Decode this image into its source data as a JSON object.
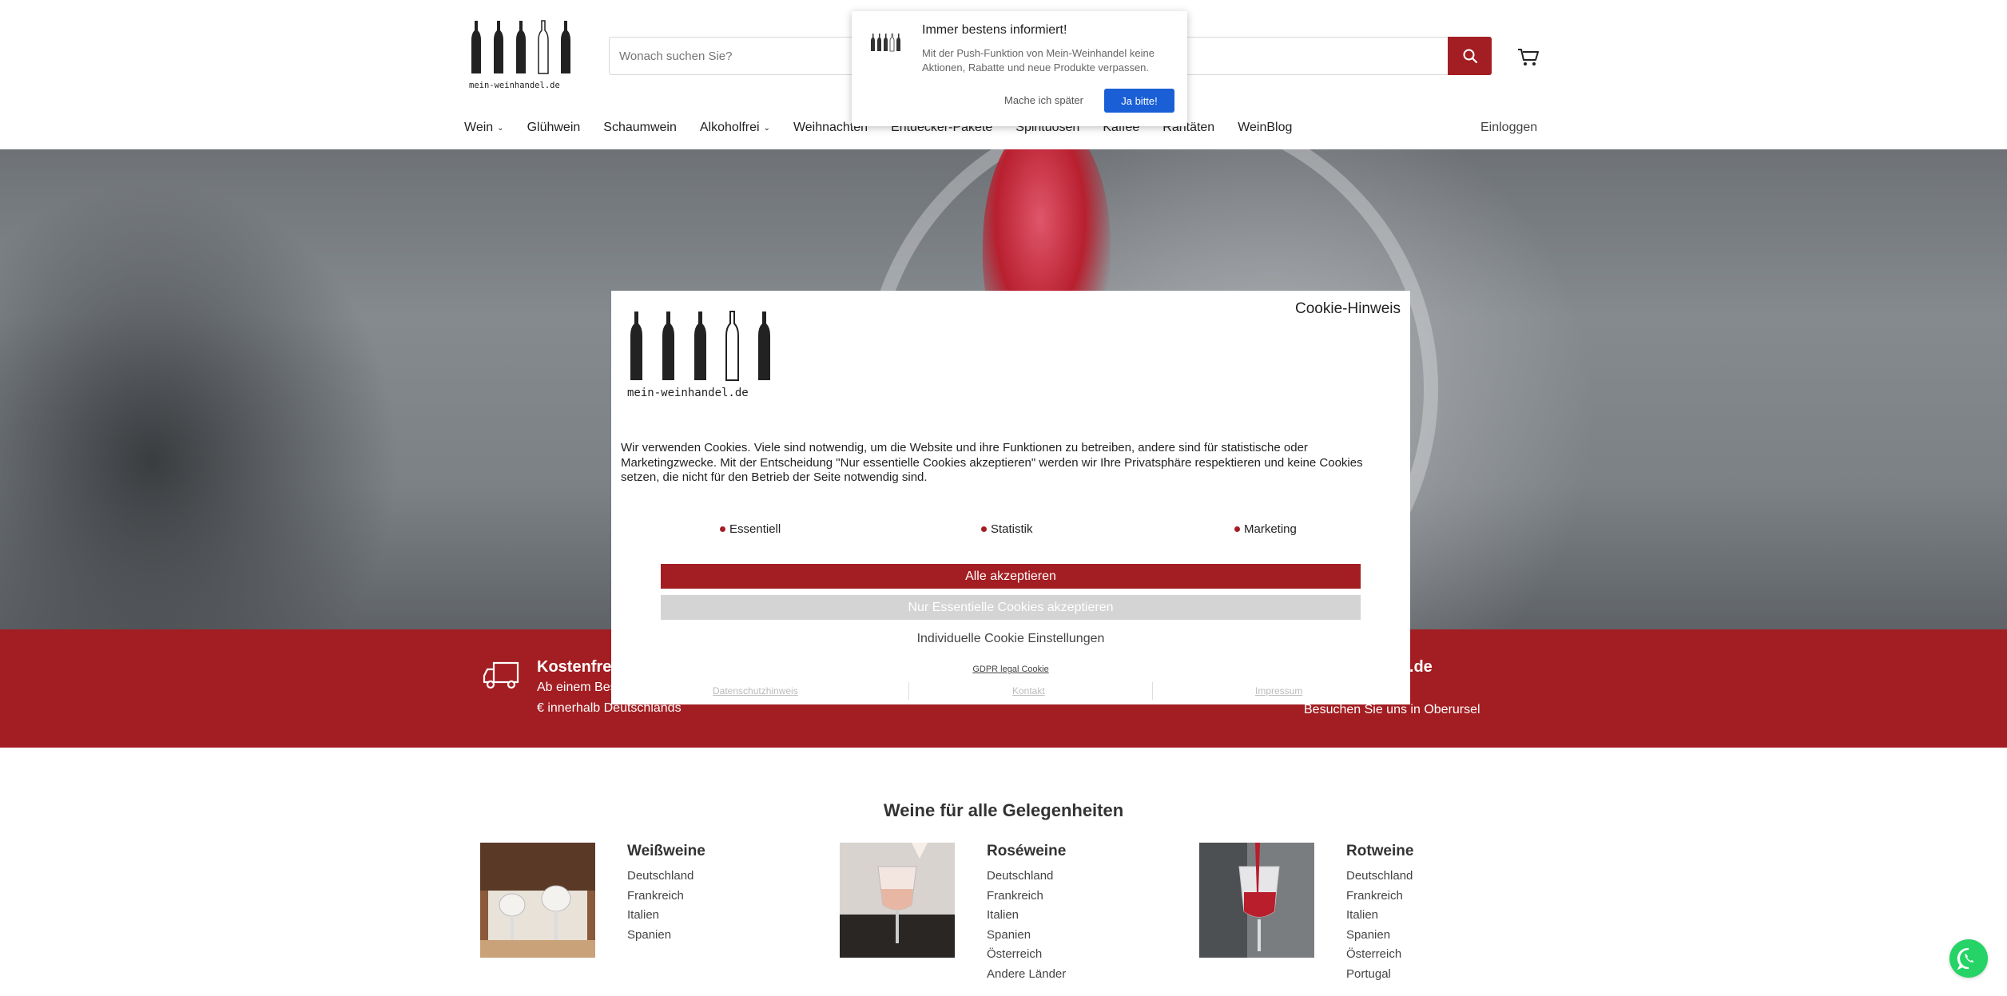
{
  "header": {
    "logo_text": "mein-weinhandel.de",
    "search_placeholder": "Wonach suchen Sie?",
    "login_label": "Einloggen"
  },
  "nav": {
    "items": [
      {
        "label": "Wein",
        "has_dropdown": true
      },
      {
        "label": "Glühwein",
        "has_dropdown": false
      },
      {
        "label": "Schaumwein",
        "has_dropdown": false
      },
      {
        "label": "Alkoholfrei",
        "has_dropdown": true
      },
      {
        "label": "Weihnachten",
        "has_dropdown": false
      },
      {
        "label": "Entdecker-Pakete",
        "has_dropdown": false
      },
      {
        "label": "Spirituosen",
        "has_dropdown": false
      },
      {
        "label": "Kaffee",
        "has_dropdown": false
      },
      {
        "label": "Raritäten",
        "has_dropdown": false
      },
      {
        "label": "WeinBlog",
        "has_dropdown": false
      }
    ]
  },
  "push_popup": {
    "title": "Immer bestens informiert!",
    "text": "Mit der Push-Funktion von Mein-Weinhandel keine Aktionen, Rabatte und neue Produkte verpassen.",
    "later_label": "Mache ich später",
    "accept_label": "Ja bitte!"
  },
  "band": {
    "left_title": "Kostenfrei",
    "left_line1": "Ab einem Bes",
    "left_line2": "€ innerhalb Deutschlands",
    "right_title": "del.de",
    "right_line": "Besuchen Sie uns  in Oberursel"
  },
  "cookie": {
    "title": "Cookie-Hinweis",
    "logo_text": "mein-weinhandel.de",
    "text": "Wir verwenden Cookies. Viele sind notwendig, um die Website und ihre Funktionen zu betreiben, andere sind für statistische oder Marketingzwecke. Mit der Entscheidung \"Nur essentielle Cookies akzeptieren\" werden wir Ihre Privatsphäre respektieren und keine Cookies setzen, die nicht für den Betrieb der Seite notwendig sind.",
    "categories": [
      "Essentiell",
      "Statistik",
      "Marketing"
    ],
    "accept_all_label": "Alle akzeptieren",
    "essential_label": "Nur Essentielle Cookies akzeptieren",
    "individual_label": "Individuelle Cookie Einstellungen",
    "gdpr_label": "GDPR legal Cookie",
    "links": [
      "Datenschutzhinweis",
      "Kontakt",
      "Impressum"
    ]
  },
  "categories_section": {
    "title": "Weine für alle Gelegenheiten",
    "items": [
      {
        "name": "Weißweine",
        "countries": [
          "Deutschland",
          "Frankreich",
          "Italien",
          "Spanien"
        ]
      },
      {
        "name": "Roséweine",
        "countries": [
          "Deutschland",
          "Frankreich",
          "Italien",
          "Spanien",
          "Österreich",
          "Andere Länder"
        ]
      },
      {
        "name": "Rotweine",
        "countries": [
          "Deutschland",
          "Frankreich",
          "Italien",
          "Spanien",
          "Österreich",
          "Portugal"
        ]
      }
    ]
  },
  "colors": {
    "brand_red": "#a31e22",
    "push_blue": "#1a5fd6",
    "whatsapp_green": "#25d366"
  }
}
